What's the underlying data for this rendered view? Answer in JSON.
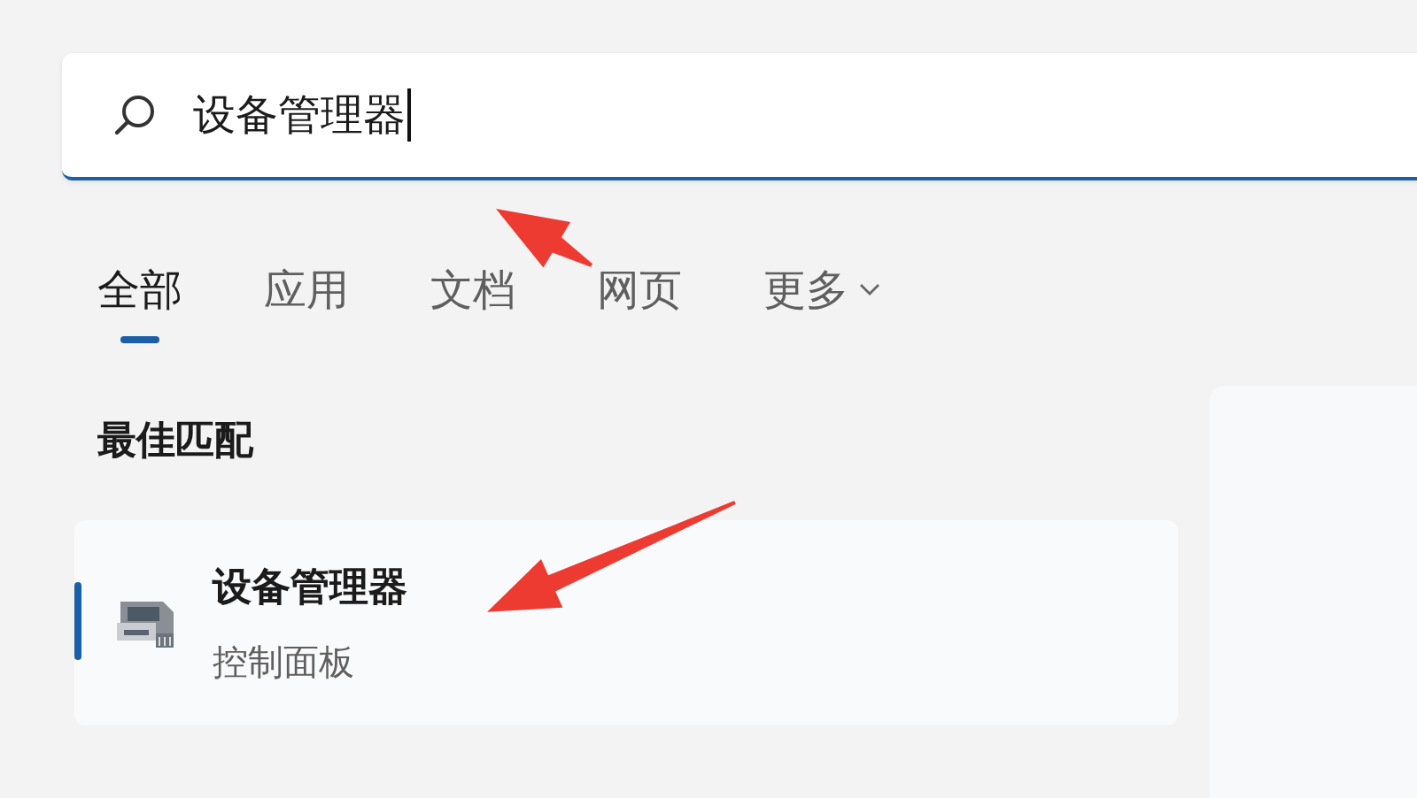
{
  "search": {
    "value": "设备管理器"
  },
  "tabs": [
    {
      "label": "全部",
      "selected": true,
      "kind": "plain"
    },
    {
      "label": "应用",
      "selected": false,
      "kind": "plain"
    },
    {
      "label": "文档",
      "selected": false,
      "kind": "plain"
    },
    {
      "label": "网页",
      "selected": false,
      "kind": "plain"
    },
    {
      "label": "更多",
      "selected": false,
      "kind": "dropdown"
    }
  ],
  "best_match": {
    "heading": "最佳匹配",
    "results": [
      {
        "title": "设备管理器",
        "subtitle": "控制面板",
        "selected": true
      }
    ]
  }
}
